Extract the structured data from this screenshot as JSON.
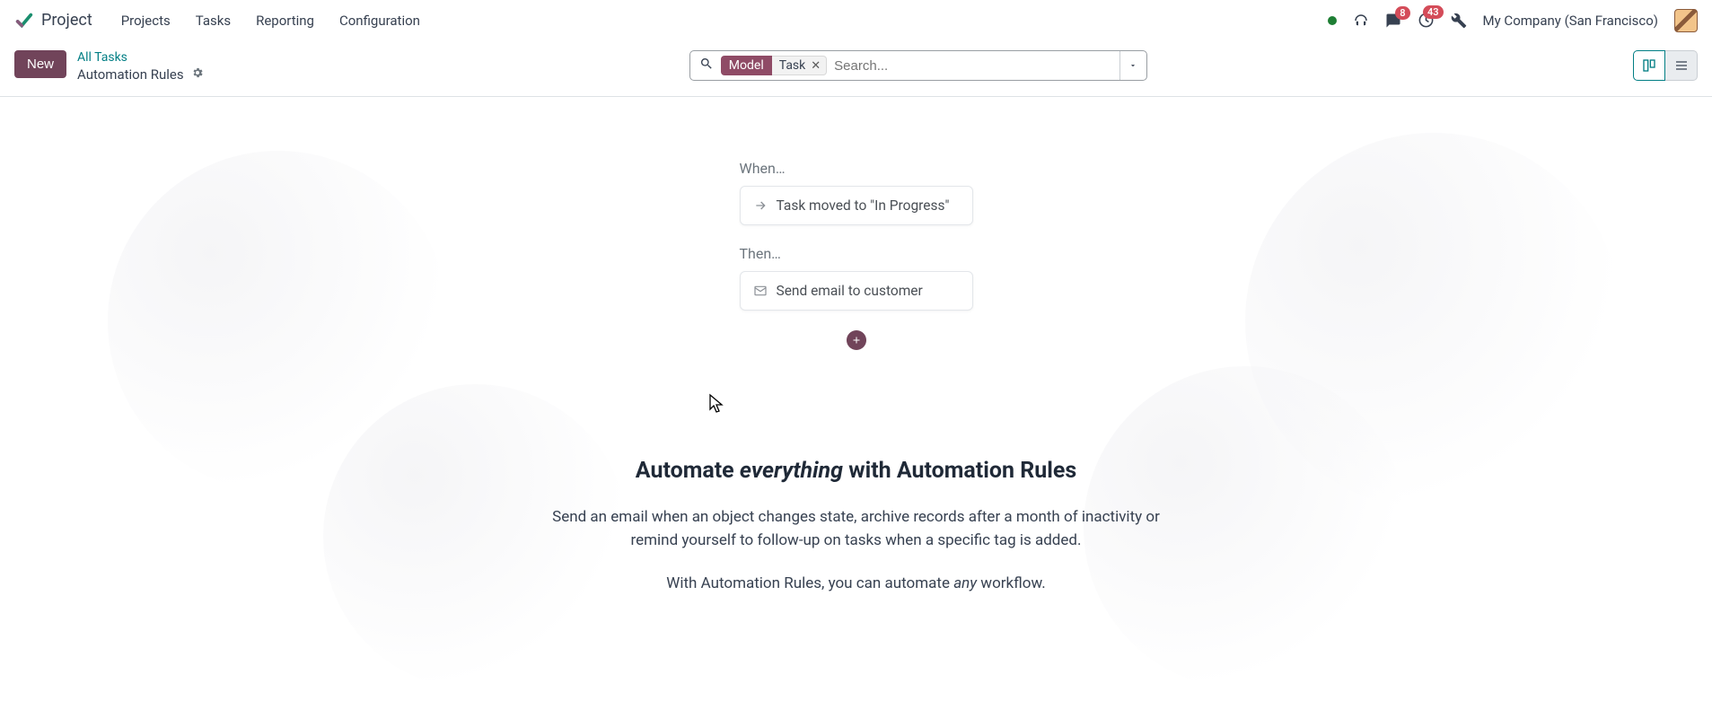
{
  "app": {
    "name": "Project"
  },
  "menu": {
    "projects": "Projects",
    "tasks": "Tasks",
    "reporting": "Reporting",
    "configuration": "Configuration"
  },
  "systray": {
    "messages_badge": "8",
    "activities_badge": "43",
    "company": "My Company (San Francisco)"
  },
  "control_panel": {
    "new_label": "New",
    "breadcrumb_top": "All Tasks",
    "breadcrumb_bottom": "Automation Rules"
  },
  "search": {
    "facet_label": "Model",
    "facet_value": "Task",
    "placeholder": "Search..."
  },
  "rule_preview": {
    "when_label": "When…",
    "when_text": "Task moved to \"In Progress\"",
    "then_label": "Then…",
    "then_text": "Send email to customer"
  },
  "empty_state": {
    "headline_pre": "Automate ",
    "headline_em": "everything",
    "headline_post": " with Automation Rules",
    "para1": "Send an email when an object changes state, archive records after a month of inactivity or remind yourself to follow-up on tasks when a specific tag is added.",
    "para2_pre": "With Automation Rules, you can automate ",
    "para2_em": "any",
    "para2_post": " workflow."
  }
}
